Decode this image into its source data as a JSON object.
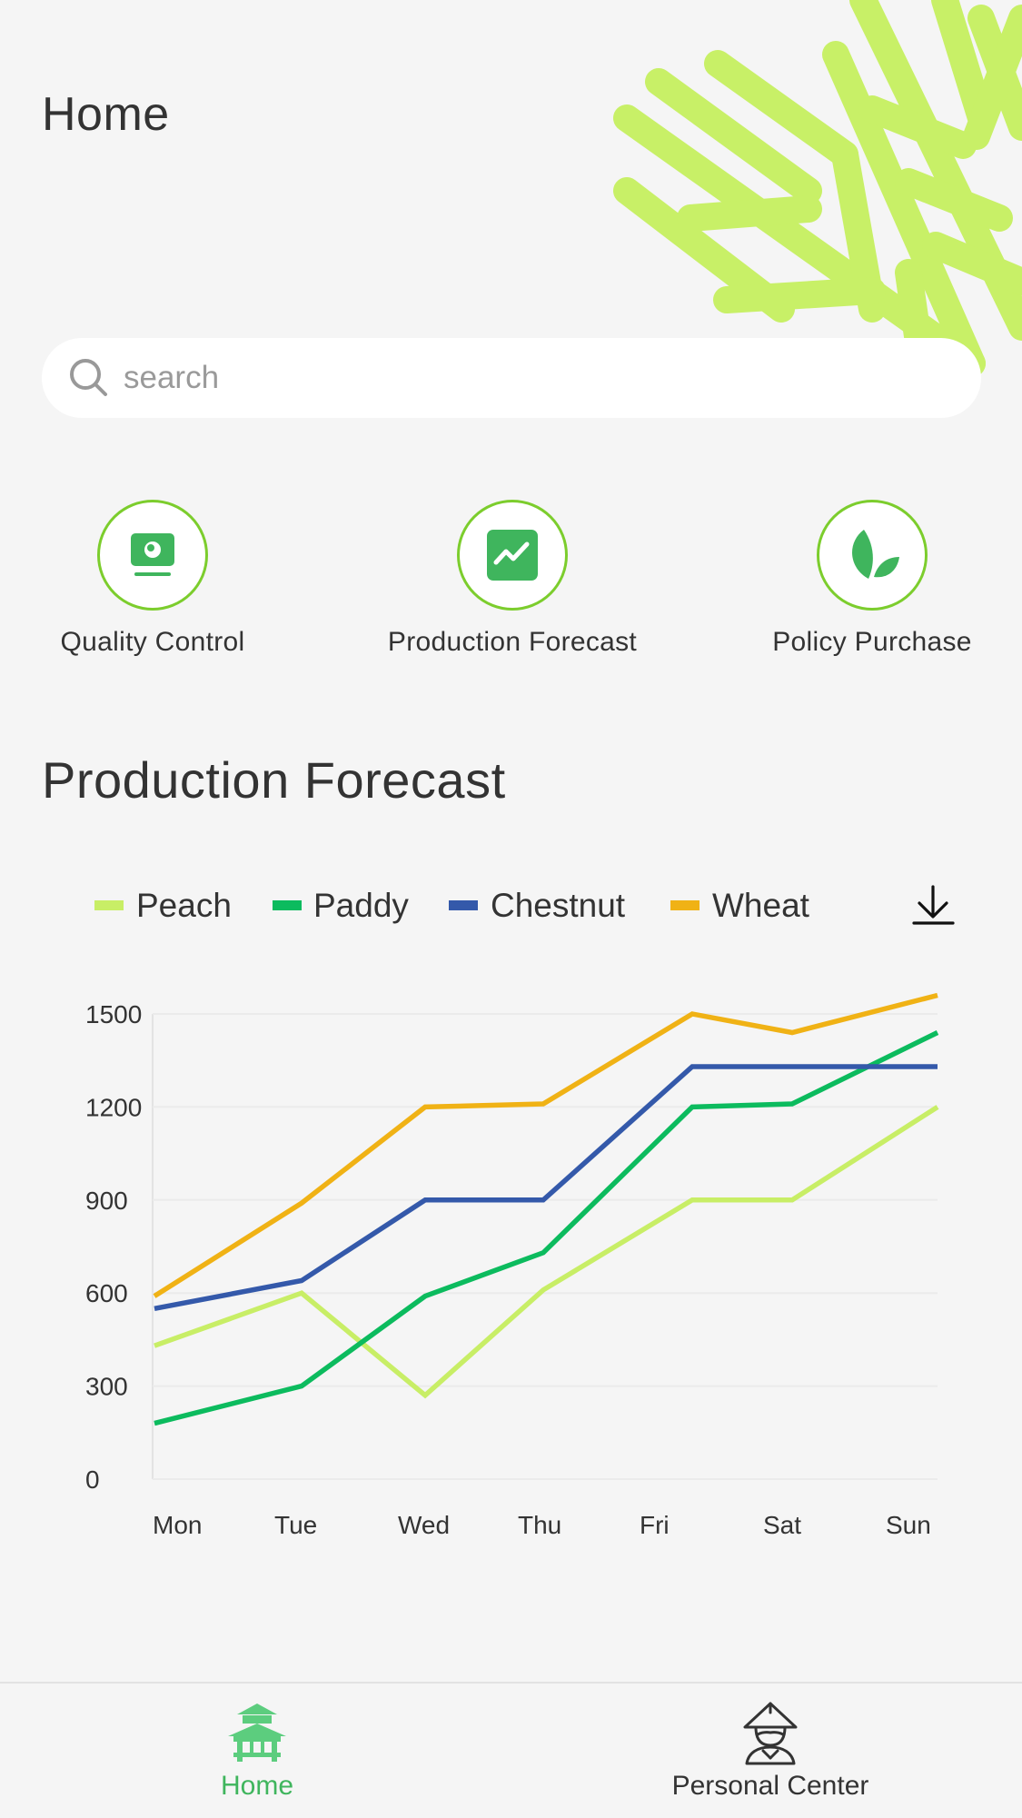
{
  "header": {
    "title": "Home"
  },
  "search": {
    "placeholder": "search"
  },
  "shortcuts": [
    {
      "label": "Quality Control",
      "icon": "monitor-icon"
    },
    {
      "label": "Production Forecast",
      "icon": "trend-chart-icon"
    },
    {
      "label": "Policy Purchase",
      "icon": "leaf-icon"
    }
  ],
  "section": {
    "title": "Production Forecast"
  },
  "download_icon": "download-icon",
  "chart_data": {
    "type": "line",
    "categories": [
      "Mon",
      "Tue",
      "Wed",
      "Thu",
      "Fri",
      "Sat",
      "Sun"
    ],
    "ylim": [
      0,
      1500
    ],
    "yticks": [
      0,
      300,
      600,
      900,
      1200,
      1500
    ],
    "grid": true,
    "legend": "top",
    "series": [
      {
        "name": "Peach",
        "color": "#c8ee66",
        "values": [
          430,
          600,
          270,
          610,
          900,
          900,
          1200
        ]
      },
      {
        "name": "Paddy",
        "color": "#0cbb5e",
        "values": [
          180,
          300,
          590,
          730,
          1200,
          1210,
          1440
        ]
      },
      {
        "name": "Chestnut",
        "color": "#3459aa",
        "values": [
          550,
          640,
          900,
          900,
          1330,
          1330,
          1330
        ]
      },
      {
        "name": "Wheat",
        "color": "#f0b215",
        "values": [
          590,
          890,
          1200,
          1210,
          1500,
          1440,
          1560
        ]
      }
    ]
  },
  "tabbar": {
    "home": {
      "label": "Home",
      "icon": "pagoda-icon"
    },
    "personal": {
      "label": "Personal Center",
      "icon": "farmer-avatar-icon"
    }
  },
  "colors": {
    "accent": "#3fb55d",
    "decor": "#c8f067",
    "ring": "#7ccd2d"
  }
}
